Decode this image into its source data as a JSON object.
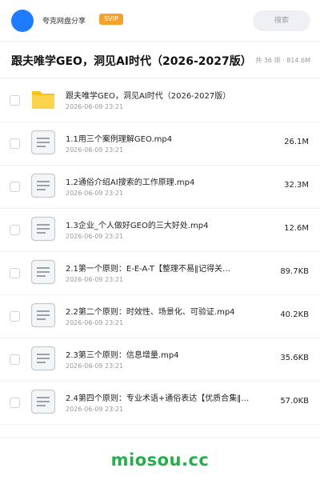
{
  "header": {
    "app_name": "夸克网盘分享",
    "badge": "SVIP",
    "search_label": "搜索",
    "accent_color": "#1f7bff",
    "badge_color": "#f5a12b"
  },
  "title_bar": {
    "title": "跟夫唯学GEO，洞见AI时代（2026-2027版）",
    "meta": "共 36 项 · 814.6M"
  },
  "files": [
    {
      "name": "跟夫唯学GEO，洞见AI时代（2026-2027版）",
      "date": "2026-06-09 23:21",
      "size": "",
      "icon": "folder-icon"
    },
    {
      "name": "1.1用三个案例理解GEO.mp4",
      "date": "2026-06-09 23:21",
      "size": "26.1M",
      "icon": "file-icon"
    },
    {
      "name": "1.2通俗介绍AI搜索的工作原理.mp4",
      "date": "2026-06-09 23:21",
      "size": "32.3M",
      "icon": "file-icon"
    },
    {
      "name": "1.3企业_个人做好GEO的三大好处.mp4",
      "date": "2026-06-09 23:21",
      "size": "12.6M",
      "icon": "file-icon"
    },
    {
      "name": "2.1第一个原则：E-E-A-T【整理不易‖记得关…",
      "date": "2026-06-09 23:21",
      "size": "89.7KB",
      "icon": "file-icon"
    },
    {
      "name": "2.2第二个原则：时效性、场景化、可验证.mp4",
      "date": "2026-06-09 23:21",
      "size": "40.2KB",
      "icon": "file-icon"
    },
    {
      "name": "2.3第三个原则：信息增量.mp4",
      "date": "2026-06-09 23:21",
      "size": "35.6KB",
      "icon": "file-icon"
    },
    {
      "name": "2.4第四个原则：专业术语+通俗表达【优质合集‖免…",
      "date": "2026-06-09 23:21",
      "size": "57.0KB",
      "icon": "file-icon"
    }
  ],
  "watermark": "miosou.cc"
}
